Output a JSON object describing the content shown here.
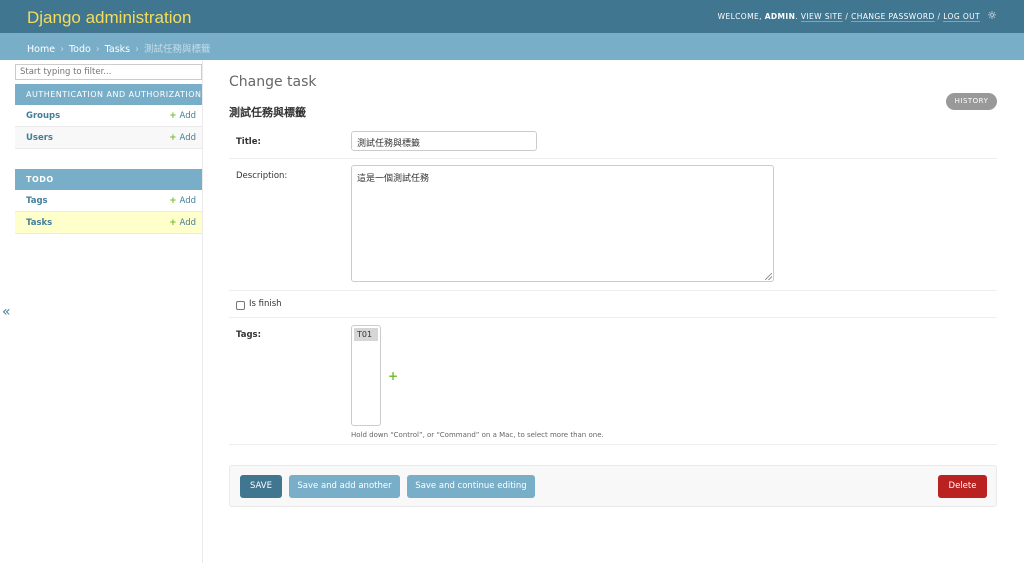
{
  "header": {
    "brand": "Django administration",
    "user_tools": {
      "welcome": "Welcome,",
      "username": "admin",
      "view_site": "View site",
      "separator": " / ",
      "change_password": "Change password",
      "log_out": "Log out"
    },
    "theme_icon": "sun-icon"
  },
  "breadcrumbs": {
    "items": [
      "Home",
      "Todo",
      "Tasks"
    ],
    "current": "測試任務與標籤",
    "separator": "›"
  },
  "sidebar": {
    "filter_placeholder": "Start typing to filter...",
    "apps": [
      {
        "caption": "Authentication and Authorization",
        "models": [
          {
            "name": "Groups",
            "add": "Add"
          },
          {
            "name": "Users",
            "add": "Add"
          }
        ]
      },
      {
        "caption": "Todo",
        "models": [
          {
            "name": "Tags",
            "add": "Add"
          },
          {
            "name": "Tasks",
            "add": "Add"
          }
        ]
      }
    ],
    "collapse_icon": "«"
  },
  "content": {
    "title": "Change task",
    "subtitle": "測試任務與標籤",
    "history": "History",
    "fields": {
      "title_label": "Title:",
      "title_value": "測試任務與標籤",
      "description_label": "Description:",
      "description_value": "這是一個測試任務",
      "is_finish_label": "Is finish",
      "tags_label": "Tags:",
      "tags_options": [
        "T01"
      ],
      "tags_add": "+",
      "tags_help": "Hold down “Control”, or “Command” on a Mac, to select more than one."
    }
  },
  "submit_row": {
    "save": "SAVE",
    "save_add_another": "Save and add another",
    "save_continue": "Save and continue editing",
    "delete": "Delete"
  },
  "colors": {
    "header_bg": "#417690",
    "brand": "#f5dd5d",
    "breadcrumb_bg": "#79aec8",
    "link": "#447e9b",
    "add_plus": "#70bf2b",
    "current_row": "#ffffcc",
    "delete": "#ba2121"
  }
}
